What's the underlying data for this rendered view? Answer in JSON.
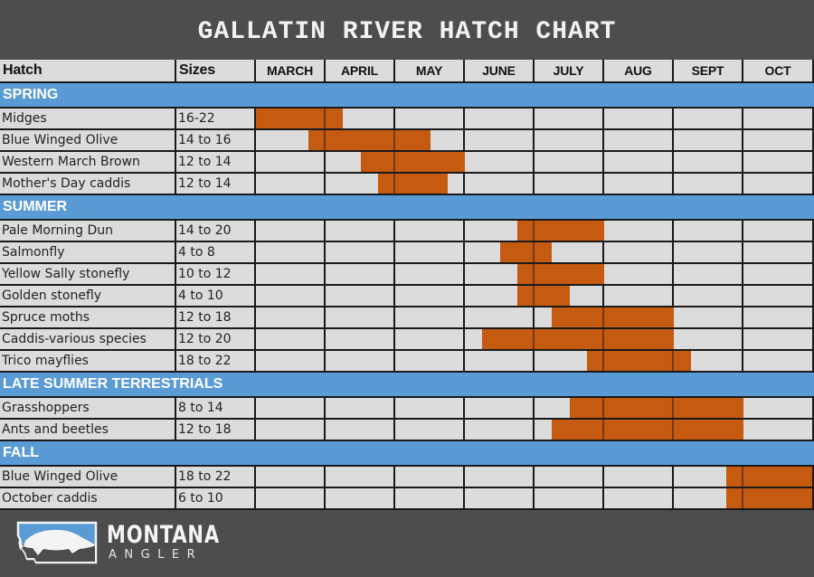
{
  "title": "GALLATIN RIVER HATCH CHART",
  "colors": {
    "background": "#4d4d4d",
    "section": "#5b9bd5",
    "cell": "#dcdcdc",
    "bar": "#c55a11"
  },
  "logo": {
    "line1": "MONTANA",
    "line2": "ANGLER",
    "icon": "montana-trout-logo-icon"
  },
  "chart_data": {
    "type": "table",
    "title": "GALLATIN RIVER HATCH CHART",
    "columns": [
      "Hatch",
      "Sizes",
      "MARCH",
      "APRIL",
      "MAY",
      "JUNE",
      "JULY",
      "AUG",
      "SEPT",
      "OCT"
    ],
    "months": [
      "MARCH",
      "APRIL",
      "MAY",
      "JUNE",
      "JULY",
      "AUG",
      "SEPT",
      "OCT"
    ],
    "period_note": "Bars are given as [start, end] in months from the start of March (each month split in quarters).",
    "sections": [
      {
        "name": "SPRING",
        "hatches": [
          {
            "name": "Midges",
            "sizes": "16-22",
            "period": [
              0,
              1.25
            ]
          },
          {
            "name": "Blue Winged Olive",
            "sizes": "14 to 16",
            "period": [
              0.75,
              2.5
            ]
          },
          {
            "name": "Western March Brown",
            "sizes": "12 to 14",
            "period": [
              1.5,
              3.0
            ]
          },
          {
            "name": "Mother's Day caddis",
            "sizes": "12 to 14",
            "period": [
              1.75,
              2.75
            ]
          }
        ]
      },
      {
        "name": "SUMMER",
        "hatches": [
          {
            "name": "Pale Morning Dun",
            "sizes": "14 to 20",
            "period": [
              3.75,
              5.0
            ]
          },
          {
            "name": "Salmonfly",
            "sizes": "4 to 8",
            "period": [
              3.5,
              4.25
            ]
          },
          {
            "name": "Yellow Sally stonefly",
            "sizes": "10 to 12",
            "period": [
              3.75,
              5.0
            ]
          },
          {
            "name": "Golden stonefly",
            "sizes": "4 to 10",
            "period": [
              3.75,
              4.5
            ]
          },
          {
            "name": "Spruce moths",
            "sizes": "12 to 18",
            "period": [
              4.25,
              6.0
            ]
          },
          {
            "name": "Caddis-various species",
            "sizes": "12 to 20",
            "period": [
              3.25,
              6.0
            ]
          },
          {
            "name": "Trico mayflies",
            "sizes": "18 to 22",
            "period": [
              4.75,
              6.25
            ]
          }
        ]
      },
      {
        "name": "LATE SUMMER TERRESTRIALS",
        "hatches": [
          {
            "name": "Grasshoppers",
            "sizes": "8 to 14",
            "period": [
              4.5,
              7.0
            ]
          },
          {
            "name": "Ants and beetles",
            "sizes": "12 to 18",
            "period": [
              4.25,
              7.0
            ]
          }
        ]
      },
      {
        "name": "FALL",
        "hatches": [
          {
            "name": "Blue Winged Olive",
            "sizes": "18 to 22",
            "period": [
              6.75,
              8.0
            ]
          },
          {
            "name": "October caddis",
            "sizes": "6 to 10",
            "period": [
              6.75,
              8.0
            ]
          }
        ]
      }
    ]
  }
}
